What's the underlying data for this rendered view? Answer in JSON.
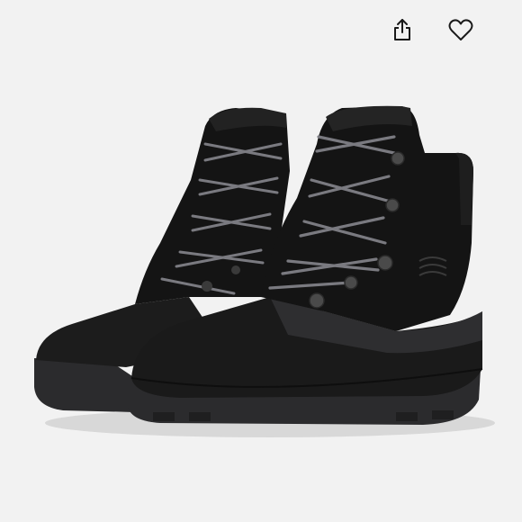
{
  "toolbar": {
    "share_icon": "share-icon",
    "favorite_icon": "heart-icon"
  },
  "product": {
    "image_subject": "boots-pair"
  },
  "colors": {
    "background": "#f2f2f2",
    "boot_upper": "#141414",
    "boot_sole": "#2b2b2d",
    "lace": "#7a7a80",
    "icon": "#1a1a1a"
  }
}
